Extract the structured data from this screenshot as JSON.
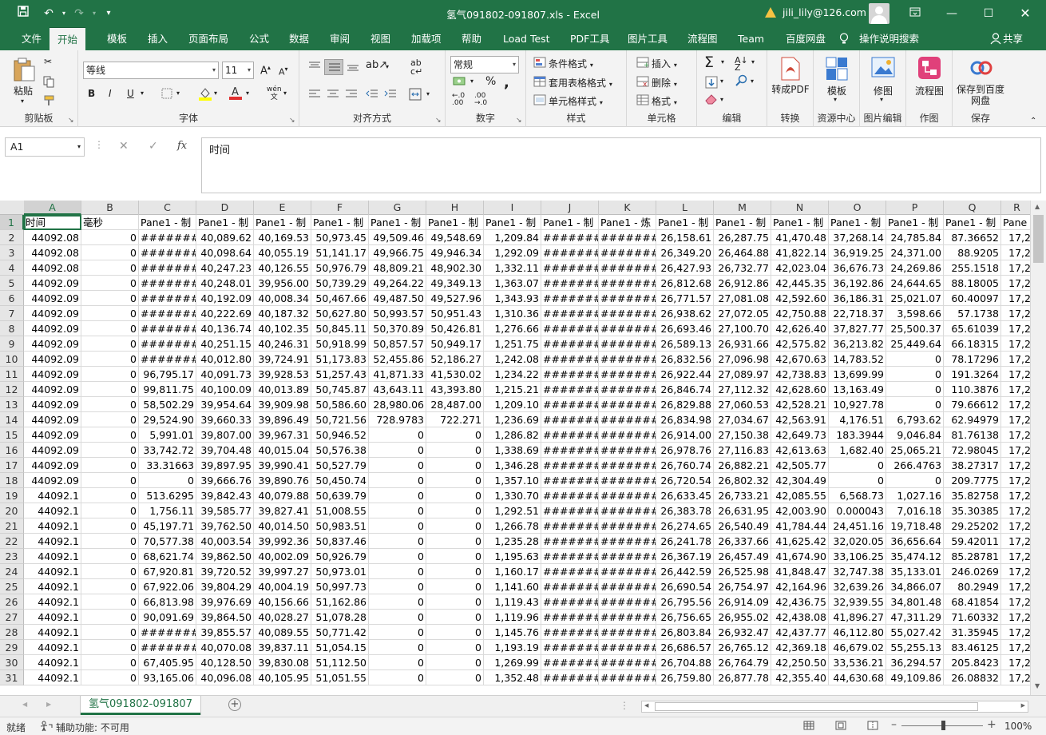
{
  "title": "氢气091802-091807.xls  -  Excel",
  "account": {
    "email": "jili_lily@126.com"
  },
  "menu_tabs": [
    "文件",
    "开始",
    "模板",
    "插入",
    "页面布局",
    "公式",
    "数据",
    "审阅",
    "视图",
    "加载项",
    "帮助",
    "Load Test",
    "PDF工具",
    "图片工具",
    "流程图",
    "Team",
    "百度网盘"
  ],
  "active_tab": "开始",
  "tell_me": "操作说明搜索",
  "share": "共享",
  "ribbon": {
    "clipboard": {
      "label": "剪贴板",
      "paste": "粘贴"
    },
    "font": {
      "label": "字体",
      "name": "等线",
      "size": "11",
      "bold": "B",
      "italic": "I",
      "underline": "U"
    },
    "alignment": {
      "label": "对齐方式"
    },
    "number": {
      "label": "数字",
      "format": "常规",
      "percent": "%"
    },
    "styles": {
      "label": "样式",
      "cond": "条件格式",
      "table": "套用表格格式",
      "cell": "单元格样式"
    },
    "cells": {
      "label": "单元格",
      "insert": "插入",
      "delete": "删除",
      "format": "格式"
    },
    "editing": {
      "label": "编辑"
    },
    "convert": {
      "label": "转换",
      "button": "转成PDF"
    },
    "resource": {
      "label": "资源中心",
      "button": "模板"
    },
    "image_edit": {
      "label": "图片编辑",
      "button": "修图"
    },
    "draw": {
      "label": "作图",
      "button": "流程图"
    },
    "save": {
      "label": "保存",
      "button": "保存到百度网盘"
    }
  },
  "name_box": "A1",
  "formula": "时间",
  "columns": [
    "A",
    "B",
    "C",
    "D",
    "E",
    "F",
    "G",
    "H",
    "I",
    "J",
    "K",
    "L",
    "M",
    "N",
    "O",
    "P",
    "Q",
    "R"
  ],
  "rows": [
    [
      "时间",
      "毫秒",
      "Pane1 - 制",
      "Pane1 - 制",
      "Pane1 - 制",
      "Pane1 - 制",
      "Pane1 - 制",
      "Pane1 - 制",
      "Pane1 - 制",
      "Pane1 - 制",
      "Pane1 - 炼",
      "Pane1 - 制",
      "Pane1 - 制",
      "Pane1 - 制",
      "Pane1 - 制",
      "Pane1 - 制",
      "Pane1 - 制",
      "Pane"
    ],
    [
      "44092.08",
      "0",
      "#######",
      "40,089.62",
      "40,169.53",
      "50,973.45",
      "49,509.46",
      "49,548.69",
      "1,209.84",
      "#######",
      "#######",
      "26,158.61",
      "26,287.75",
      "41,470.48",
      "37,268.14",
      "24,785.84",
      "87.36652",
      "17,2"
    ],
    [
      "44092.08",
      "0",
      "#######",
      "40,098.64",
      "40,055.19",
      "51,141.17",
      "49,966.75",
      "49,946.34",
      "1,292.09",
      "#######",
      "#######",
      "26,349.20",
      "26,464.88",
      "41,822.14",
      "36,919.25",
      "24,371.00",
      "88.9205",
      "17,2"
    ],
    [
      "44092.08",
      "0",
      "#######",
      "40,247.23",
      "40,126.55",
      "50,976.79",
      "48,809.21",
      "48,902.30",
      "1,332.11",
      "#######",
      "#######",
      "26,427.93",
      "26,732.77",
      "42,023.04",
      "36,676.73",
      "24,269.86",
      "255.1518",
      "17,2"
    ],
    [
      "44092.09",
      "0",
      "#######",
      "40,248.01",
      "39,956.00",
      "50,739.29",
      "49,264.22",
      "49,349.13",
      "1,363.07",
      "#######",
      "#######",
      "26,812.68",
      "26,912.86",
      "42,445.35",
      "36,192.86",
      "24,644.65",
      "88.18005",
      "17,2"
    ],
    [
      "44092.09",
      "0",
      "#######",
      "40,192.09",
      "40,008.34",
      "50,467.66",
      "49,487.50",
      "49,527.96",
      "1,343.93",
      "#######",
      "#######",
      "26,771.57",
      "27,081.08",
      "42,592.60",
      "36,186.31",
      "25,021.07",
      "60.40097",
      "17,2"
    ],
    [
      "44092.09",
      "0",
      "#######",
      "40,222.69",
      "40,187.32",
      "50,627.80",
      "50,993.57",
      "50,951.43",
      "1,310.36",
      "#######",
      "#######",
      "26,938.62",
      "27,072.05",
      "42,750.88",
      "22,718.37",
      "3,598.66",
      "57.1738",
      "17,2"
    ],
    [
      "44092.09",
      "0",
      "#######",
      "40,136.74",
      "40,102.35",
      "50,845.11",
      "50,370.89",
      "50,426.81",
      "1,276.66",
      "#######",
      "#######",
      "26,693.46",
      "27,100.70",
      "42,626.40",
      "37,827.77",
      "25,500.37",
      "65.61039",
      "17,2"
    ],
    [
      "44092.09",
      "0",
      "#######",
      "40,251.15",
      "40,246.31",
      "50,918.99",
      "50,857.57",
      "50,949.17",
      "1,251.75",
      "#######",
      "#######",
      "26,589.13",
      "26,931.66",
      "42,575.82",
      "36,213.82",
      "25,449.64",
      "66.18315",
      "17,2"
    ],
    [
      "44092.09",
      "0",
      "#######",
      "40,012.80",
      "39,724.91",
      "51,173.83",
      "52,455.86",
      "52,186.27",
      "1,242.08",
      "#######",
      "#######",
      "26,832.56",
      "27,096.98",
      "42,670.63",
      "14,783.52",
      "0",
      "78.17296",
      "17,2"
    ],
    [
      "44092.09",
      "0",
      "96,795.17",
      "40,091.73",
      "39,928.53",
      "51,257.43",
      "41,871.33",
      "41,530.02",
      "1,234.22",
      "#######",
      "#######",
      "26,922.44",
      "27,089.97",
      "42,738.83",
      "13,699.99",
      "0",
      "191.3264",
      "17,2"
    ],
    [
      "44092.09",
      "0",
      "99,811.75",
      "40,100.09",
      "40,013.89",
      "50,745.87",
      "43,643.11",
      "43,393.80",
      "1,215.21",
      "#######",
      "#######",
      "26,846.74",
      "27,112.32",
      "42,628.60",
      "13,163.49",
      "0",
      "110.3876",
      "17,2"
    ],
    [
      "44092.09",
      "0",
      "58,502.29",
      "39,954.64",
      "39,909.98",
      "50,586.60",
      "28,980.06",
      "28,487.00",
      "1,209.10",
      "#######",
      "#######",
      "26,829.88",
      "27,060.53",
      "42,528.21",
      "10,927.78",
      "0",
      "79.66612",
      "17,2"
    ],
    [
      "44092.09",
      "0",
      "29,524.90",
      "39,660.33",
      "39,896.49",
      "50,721.56",
      "728.9783",
      "722.271",
      "1,236.69",
      "#######",
      "#######",
      "26,834.98",
      "27,034.67",
      "42,563.91",
      "4,176.51",
      "6,793.62",
      "62.94979",
      "17,2"
    ],
    [
      "44092.09",
      "0",
      "5,991.01",
      "39,807.00",
      "39,967.31",
      "50,946.52",
      "0",
      "0",
      "1,286.82",
      "#######",
      "#######",
      "26,914.00",
      "27,150.38",
      "42,649.73",
      "183.3944",
      "9,046.84",
      "81.76138",
      "17,2"
    ],
    [
      "44092.09",
      "0",
      "33,742.72",
      "39,704.48",
      "40,015.04",
      "50,576.38",
      "0",
      "0",
      "1,338.69",
      "#######",
      "#######",
      "26,978.76",
      "27,116.83",
      "42,613.63",
      "1,682.40",
      "25,065.21",
      "72.98045",
      "17,2"
    ],
    [
      "44092.09",
      "0",
      "33.31663",
      "39,897.95",
      "39,990.41",
      "50,527.79",
      "0",
      "0",
      "1,346.28",
      "#######",
      "#######",
      "26,760.74",
      "26,882.21",
      "42,505.77",
      "0",
      "266.4763",
      "38.27317",
      "17,2"
    ],
    [
      "44092.09",
      "0",
      "0",
      "39,666.76",
      "39,890.76",
      "50,450.74",
      "0",
      "0",
      "1,357.10",
      "#######",
      "#######",
      "26,720.54",
      "26,802.32",
      "42,304.49",
      "0",
      "0",
      "209.7775",
      "17,2"
    ],
    [
      "44092.1",
      "0",
      "513.6295",
      "39,842.43",
      "40,079.88",
      "50,639.79",
      "0",
      "0",
      "1,330.70",
      "#######",
      "#######",
      "26,633.45",
      "26,733.21",
      "42,085.55",
      "6,568.73",
      "1,027.16",
      "35.82758",
      "17,2"
    ],
    [
      "44092.1",
      "0",
      "1,756.11",
      "39,585.77",
      "39,827.41",
      "51,008.55",
      "0",
      "0",
      "1,292.51",
      "#######",
      "#######",
      "26,383.78",
      "26,631.95",
      "42,003.90",
      "0.000043",
      "7,016.18",
      "35.30385",
      "17,2"
    ],
    [
      "44092.1",
      "0",
      "45,197.71",
      "39,762.50",
      "40,014.50",
      "50,983.51",
      "0",
      "0",
      "1,266.78",
      "#######",
      "#######",
      "26,274.65",
      "26,540.49",
      "41,784.44",
      "24,451.16",
      "19,718.48",
      "29.25202",
      "17,2"
    ],
    [
      "44092.1",
      "0",
      "70,577.38",
      "40,003.54",
      "39,992.36",
      "50,837.46",
      "0",
      "0",
      "1,235.28",
      "#######",
      "#######",
      "26,241.78",
      "26,337.66",
      "41,625.42",
      "32,020.05",
      "36,656.64",
      "59.42011",
      "17,2"
    ],
    [
      "44092.1",
      "0",
      "68,621.74",
      "39,862.50",
      "40,002.09",
      "50,926.79",
      "0",
      "0",
      "1,195.63",
      "#######",
      "#######",
      "26,367.19",
      "26,457.49",
      "41,674.90",
      "33,106.25",
      "35,474.12",
      "85.28781",
      "17,2"
    ],
    [
      "44092.1",
      "0",
      "67,920.81",
      "39,720.52",
      "39,997.27",
      "50,973.01",
      "0",
      "0",
      "1,160.17",
      "#######",
      "#######",
      "26,442.59",
      "26,525.98",
      "41,848.47",
      "32,747.38",
      "35,133.01",
      "246.0269",
      "17,2"
    ],
    [
      "44092.1",
      "0",
      "67,922.06",
      "39,804.29",
      "40,004.19",
      "50,997.73",
      "0",
      "0",
      "1,141.60",
      "#######",
      "#######",
      "26,690.54",
      "26,754.97",
      "42,164.96",
      "32,639.26",
      "34,866.07",
      "80.2949",
      "17,2"
    ],
    [
      "44092.1",
      "0",
      "66,813.98",
      "39,976.69",
      "40,156.66",
      "51,162.86",
      "0",
      "0",
      "1,119.43",
      "#######",
      "#######",
      "26,795.56",
      "26,914.09",
      "42,436.75",
      "32,939.55",
      "34,801.48",
      "68.41854",
      "17,2"
    ],
    [
      "44092.1",
      "0",
      "90,091.69",
      "39,864.50",
      "40,028.27",
      "51,078.28",
      "0",
      "0",
      "1,119.96",
      "#######",
      "#######",
      "26,756.65",
      "26,955.02",
      "42,438.08",
      "41,896.27",
      "47,311.29",
      "71.60332",
      "17,2"
    ],
    [
      "44092.1",
      "0",
      "#######",
      "39,855.57",
      "40,089.55",
      "50,771.42",
      "0",
      "0",
      "1,145.76",
      "#######",
      "#######",
      "26,803.84",
      "26,932.47",
      "42,437.77",
      "46,112.80",
      "55,027.42",
      "31.35945",
      "17,2"
    ],
    [
      "44092.1",
      "0",
      "#######",
      "40,070.08",
      "39,837.11",
      "51,054.15",
      "0",
      "0",
      "1,193.19",
      "#######",
      "#######",
      "26,686.57",
      "26,765.12",
      "42,369.18",
      "46,679.02",
      "55,255.13",
      "83.46125",
      "17,2"
    ],
    [
      "44092.1",
      "0",
      "67,405.95",
      "40,128.50",
      "39,830.08",
      "51,112.50",
      "0",
      "0",
      "1,269.99",
      "#######",
      "#######",
      "26,704.88",
      "26,764.79",
      "42,250.50",
      "33,536.21",
      "36,294.57",
      "205.8423",
      "17,2"
    ],
    [
      "44092.1",
      "0",
      "93,165.06",
      "40,096.08",
      "40,105.95",
      "51,051.55",
      "0",
      "0",
      "1,352.48",
      "#######",
      "#######",
      "26,759.80",
      "26,877.78",
      "42,355.40",
      "44,630.68",
      "49,109.86",
      "26.08832",
      "17,2"
    ]
  ],
  "sheet_tab": "氢气091802-091807",
  "status": {
    "ready": "就绪",
    "accessibility": "辅助功能: 不可用",
    "zoom": "100%"
  }
}
